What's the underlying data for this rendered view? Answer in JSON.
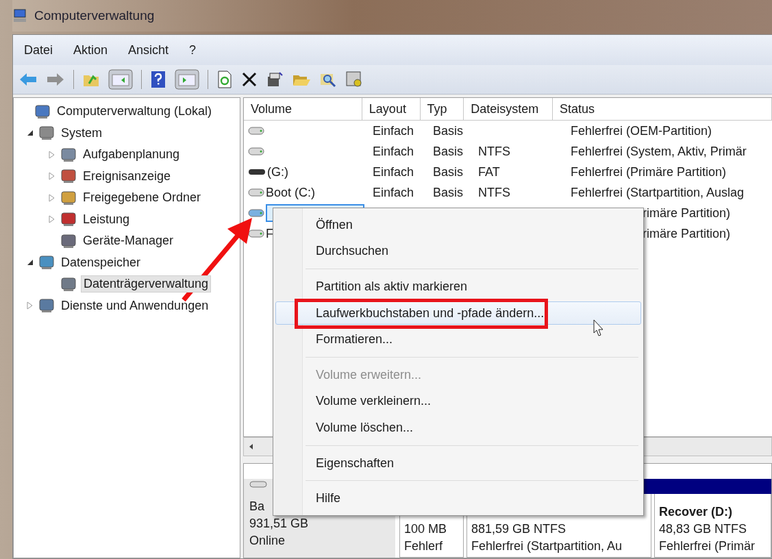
{
  "window": {
    "title": "Computerverwaltung"
  },
  "menu_bar": [
    "Datei",
    "Aktion",
    "Ansicht",
    "?"
  ],
  "tree": [
    {
      "label": "Computerverwaltung (Lokal)",
      "selected": false,
      "children": [
        {
          "label": "System",
          "expanded": true,
          "selected": false,
          "children": [
            {
              "label": "Aufgabenplanung",
              "expanded": false,
              "selected": false
            },
            {
              "label": "Ereignisanzeige",
              "expanded": false,
              "selected": false
            },
            {
              "label": "Freigegebene Ordner",
              "expanded": false,
              "selected": false
            },
            {
              "label": "Leistung",
              "expanded": false,
              "selected": false
            },
            {
              "label": "Geräte-Manager",
              "selected": false
            }
          ]
        },
        {
          "label": "Datenspeicher",
          "expanded": true,
          "selected": false,
          "children": [
            {
              "label": "Datenträgerverwaltung",
              "selected": true
            }
          ]
        },
        {
          "label": "Dienste und Anwendungen",
          "expanded": false,
          "selected": false
        }
      ]
    }
  ],
  "table": {
    "columns": [
      "Volume",
      "Layout",
      "Typ",
      "Dateisystem",
      "Status"
    ],
    "rows": [
      {
        "kind": "disk",
        "volume": "",
        "layout": "Einfach",
        "type": "Basis",
        "filesystem": "",
        "status": "Fehlerfrei (OEM-Partition)",
        "selected": false
      },
      {
        "kind": "disk",
        "volume": "",
        "layout": "Einfach",
        "type": "Basis",
        "filesystem": "NTFS",
        "status": "Fehlerfrei (System, Aktiv, Primär",
        "selected": false
      },
      {
        "kind": "removable",
        "volume": "(G:)",
        "layout": "Einfach",
        "type": "Basis",
        "filesystem": "FAT",
        "status": "Fehlerfrei (Primäre Partition)",
        "selected": false
      },
      {
        "kind": "disk",
        "volume": "Boot (C:)",
        "layout": "Einfach",
        "type": "Basis",
        "filesystem": "NTFS",
        "status": "Fehlerfrei (Startpartition, Auslag",
        "selected": false
      },
      {
        "kind": "disk",
        "volume": "",
        "status": "rimäre Partition)",
        "selected": true
      },
      {
        "kind": "disk",
        "volume": "F",
        "status": "rimäre Partition)",
        "selected": false
      }
    ]
  },
  "disk_map": {
    "disk": {
      "name": "Ba",
      "size": "931,51 GB",
      "state": "Online"
    },
    "partitions": [
      {
        "size": "100 MB",
        "status": "Fehlerf"
      },
      {
        "size": "881,59 GB NTFS",
        "status": "Fehlerfrei (Startpartition, Au"
      },
      {
        "title": "Recover  (D:)",
        "size": "48,83 GB NTFS",
        "status": "Fehlerfrei (Primär"
      }
    ]
  },
  "context_menu": [
    {
      "kind": "item",
      "label": "Öffnen",
      "disabled": false,
      "selected": false
    },
    {
      "kind": "item",
      "label": "Durchsuchen",
      "disabled": false,
      "selected": false
    },
    {
      "kind": "separator"
    },
    {
      "kind": "item",
      "label": "Partition als aktiv markieren",
      "disabled": false,
      "selected": false
    },
    {
      "kind": "item",
      "label": "Laufwerkbuchstaben und -pfade ändern...",
      "disabled": false,
      "selected": true
    },
    {
      "kind": "item",
      "label": "Formatieren...",
      "disabled": false,
      "selected": false
    },
    {
      "kind": "separator"
    },
    {
      "kind": "item",
      "label": "Volume erweitern...",
      "disabled": true,
      "selected": false
    },
    {
      "kind": "item",
      "label": "Volume verkleinern...",
      "disabled": false,
      "selected": false
    },
    {
      "kind": "item",
      "label": "Volume löschen...",
      "disabled": false,
      "selected": false
    },
    {
      "kind": "separator"
    },
    {
      "kind": "item",
      "label": "Eigenschaften",
      "disabled": false,
      "selected": false
    },
    {
      "kind": "separator"
    },
    {
      "kind": "item",
      "label": "Hilfe",
      "disabled": false,
      "selected": false
    }
  ]
}
